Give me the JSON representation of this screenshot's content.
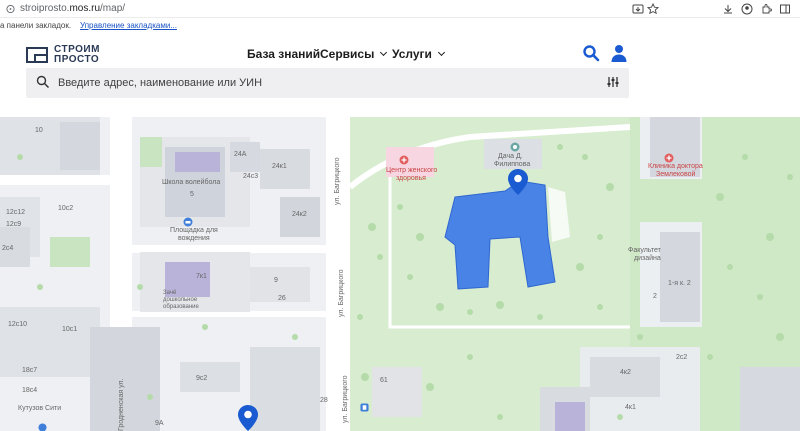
{
  "browser": {
    "url_prefix": "stroiprosto.",
    "url_domain": "mos.ru",
    "url_path": "/map/",
    "bookmarks_text": "а панели закладок.",
    "bookmarks_link": "Управление закладками..."
  },
  "header": {
    "logo_line1": "СТРОИМ",
    "logo_line2": "ПРОСТО",
    "nav": [
      {
        "label": "База знаний"
      },
      {
        "label": "Сервисы"
      },
      {
        "label": "Услуги"
      }
    ]
  },
  "search": {
    "placeholder": "Введите адрес, наименование или УИН"
  },
  "colors": {
    "accent": "#1a5bd1",
    "selection": "#3a78e8",
    "park": "#d8ecd0"
  },
  "map": {
    "labels": {
      "b10": "10",
      "b24a": "24А",
      "b24k1": "24к1",
      "school": "Школа волейбола",
      "b5": "5",
      "b24s3": "24с3",
      "b24k2": "24к2",
      "playground": "Площадка для",
      "playground2": "вождения",
      "b10s2": "10с2",
      "b12s12": "12с12",
      "b12s9": "12с9",
      "b2s4": "2с4",
      "b7k1": "7к1",
      "preschool1": "Зачё",
      "preschool2": "дошкольное",
      "preschool3": "образование",
      "b9": "9",
      "b26": "26",
      "b12s10": "12с10",
      "b10s1": "10с1",
      "b18s7": "18с7",
      "b18s4": "18с4",
      "kutuzov": "Кутузов Сити",
      "b9s2": "9с2",
      "b9a": "9А",
      "b28": "28",
      "b61": "61",
      "street1": "ул. Багрицкого",
      "street2": "ул. Багрицкого",
      "street3": "ул. Багрицкого",
      "street_left": "Гродненская ул.",
      "women_health1": "Центр женского",
      "women_health2": "здоровья",
      "dacha1": "Дача Д.",
      "dacha2": "Филиппова",
      "clinic1": "Клиника доктора",
      "clinic2": "Землековой",
      "faculty1": "Факультет",
      "faculty2": "дизайна",
      "bld_korp2": "1-я к. 2",
      "b2": "2",
      "b2s2": "2с2",
      "b4k2": "4к2",
      "b4k1": "4к1"
    }
  }
}
